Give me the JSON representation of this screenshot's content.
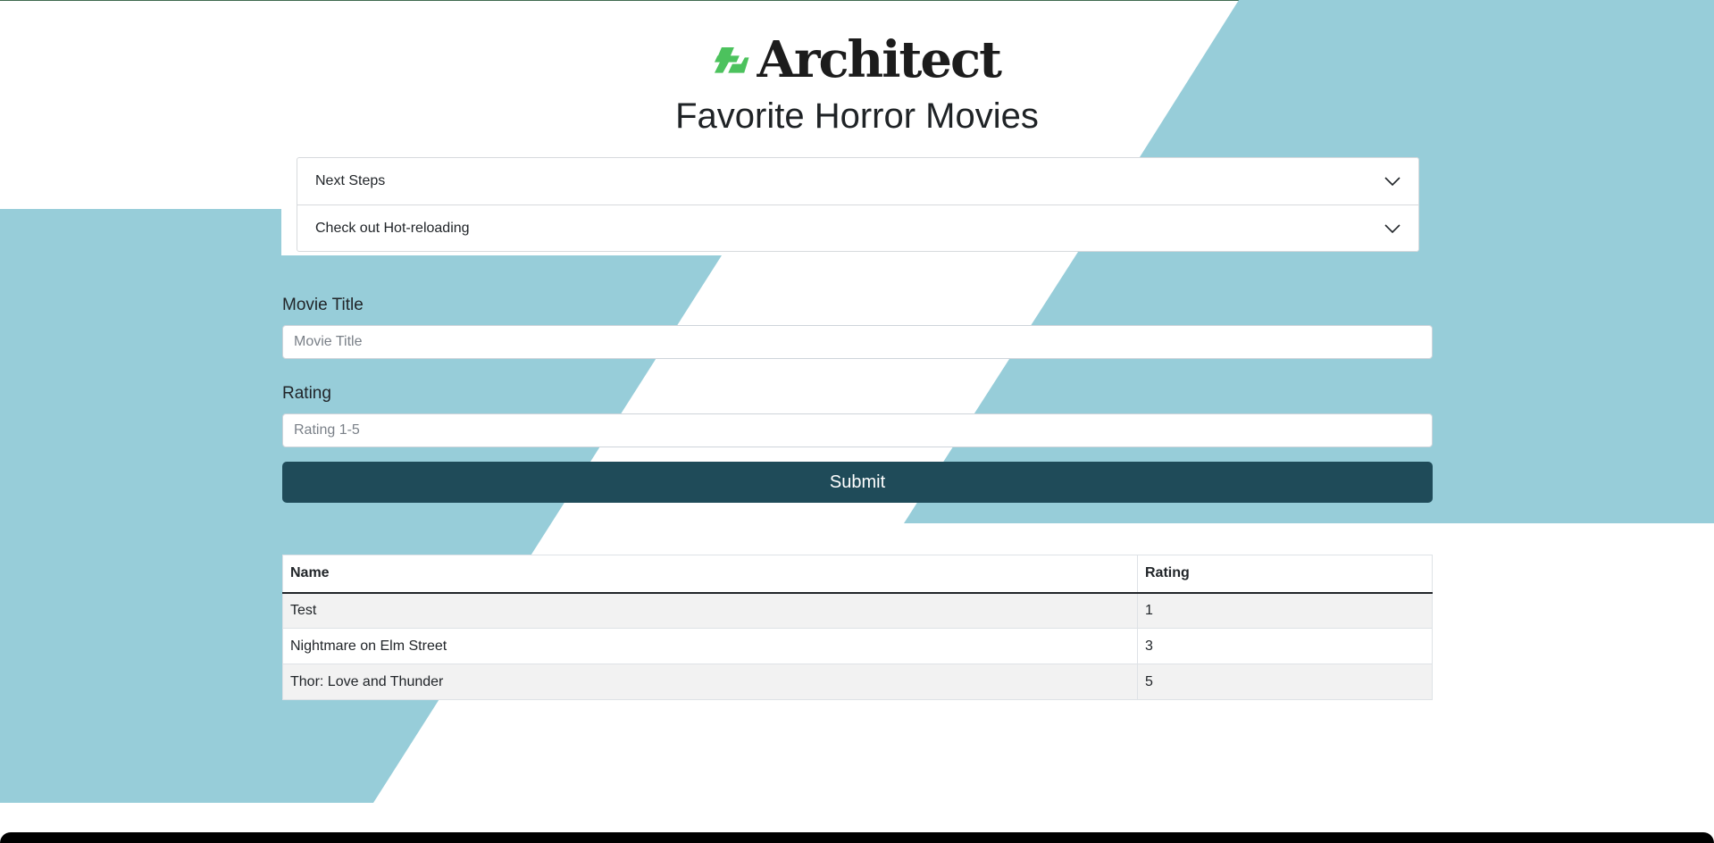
{
  "colors": {
    "background_shape": "#97cdd9",
    "logo_green": "#4cc25d",
    "submit_button": "#1f4b59"
  },
  "header": {
    "logo_text": "Architect",
    "logo_icon": "architect-logo-icon",
    "title": "Favorite Horror Movies"
  },
  "accordion": {
    "items": [
      {
        "label": "Next Steps",
        "icon": "chevron-down-icon"
      },
      {
        "label": "Check out Hot-reloading",
        "icon": "chevron-down-icon"
      }
    ]
  },
  "form": {
    "title_label": "Movie Title",
    "title_placeholder": "Movie Title",
    "title_value": "",
    "rating_label": "Rating",
    "rating_placeholder": "Rating 1-5",
    "rating_value": "",
    "submit_label": "Submit"
  },
  "table": {
    "headers": [
      "Name",
      "Rating"
    ],
    "rows": [
      [
        "Test",
        "1"
      ],
      [
        "Nightmare on Elm Street",
        "3"
      ],
      [
        "Thor: Love and Thunder",
        "5"
      ]
    ]
  }
}
